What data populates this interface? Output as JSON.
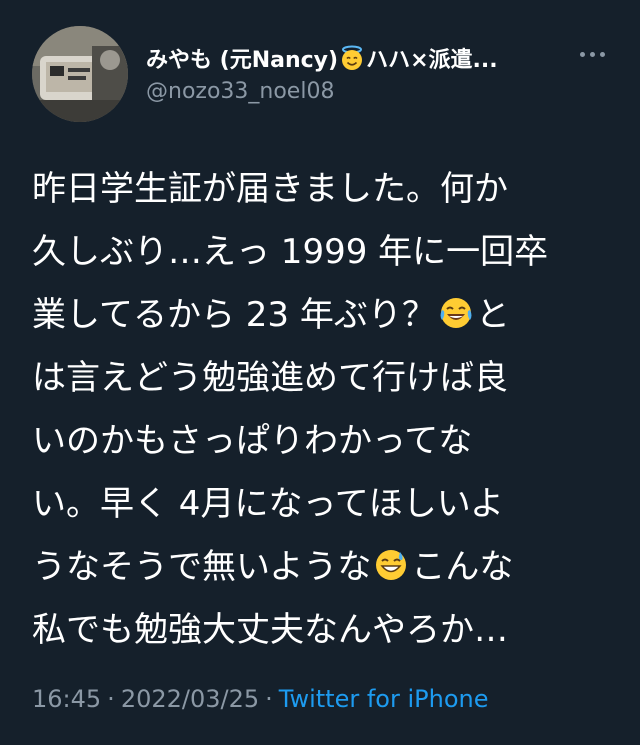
{
  "tweet": {
    "author": {
      "display_name_part1": "みやも (元Nancy)",
      "display_name_part2": "ハハ×派遣...",
      "name_emoji": "smiling-face-with-halo",
      "handle": "@nozo33_noel08"
    },
    "more_icon": "more-options-icon",
    "body_lines": [
      {
        "text": "昨日学生証が届きました。何か"
      },
      {
        "text": "久しぶり…えっ 1999 年に一回卒"
      },
      {
        "before": "業してるから 23 年ぶり？",
        "emoji": "face-with-tears-of-joy",
        "after": "と"
      },
      {
        "text": "は言えどう勉強進めて行けば良"
      },
      {
        "text": "いのかもさっぱりわかってな"
      },
      {
        "text": "い。早く 4月になってほしいよ"
      },
      {
        "before": "うなそうで無いような",
        "emoji": "grinning-face-with-sweat",
        "after": "こんな"
      },
      {
        "text": "私でも勉強大丈夫なんやろか…"
      }
    ],
    "meta": {
      "time": "16:45",
      "separator": "·",
      "date": "2022/03/25",
      "source": "Twitter for iPhone"
    }
  },
  "colors": {
    "background": "#15202b",
    "text": "#ffffff",
    "secondary": "#8b98a5",
    "link": "#1d9bf0"
  }
}
